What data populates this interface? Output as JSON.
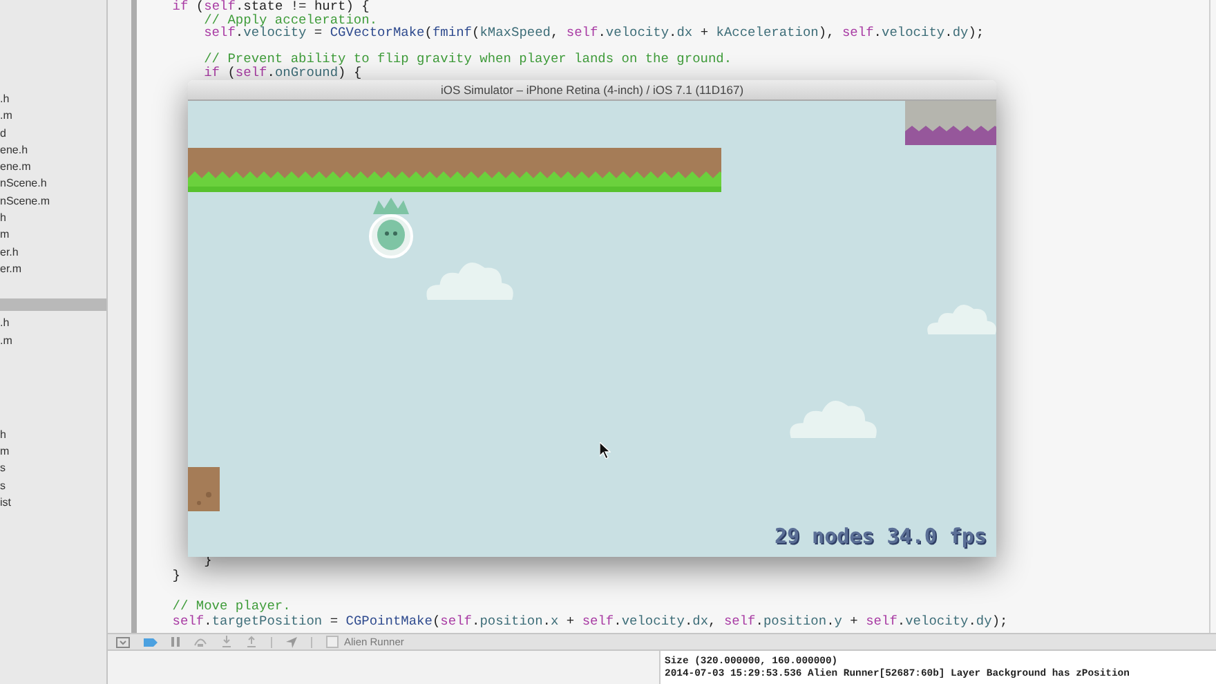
{
  "sidebar": {
    "groups": [
      {
        "items": [
          ".h",
          ".m",
          "d",
          "ene.h",
          "ene.m",
          "nScene.h",
          "nScene.m",
          "h",
          "m",
          "er.h",
          "er.m"
        ]
      },
      {
        "items": [
          ".h",
          ".m"
        ]
      },
      {
        "items": [
          "h",
          "m",
          "s",
          "s",
          "ist"
        ]
      }
    ]
  },
  "editor": {
    "lines_top": [
      {
        "kind": "code",
        "segments": [
          {
            "text": "    if",
            "kind": "kw"
          },
          {
            "text": " (",
            "kind": "plain"
          },
          {
            "text": "self",
            "kind": "kw"
          },
          {
            "text": ".state != hurt) {",
            "kind": "plain"
          }
        ]
      },
      {
        "kind": "code",
        "segments": [
          {
            "text": "        // Apply acceleration.",
            "kind": "comment"
          }
        ]
      },
      {
        "kind": "code",
        "segments": [
          {
            "text": "        self",
            "kind": "kw"
          },
          {
            "text": ".",
            "kind": "plain"
          },
          {
            "text": "velocity",
            "kind": "ident"
          },
          {
            "text": " = ",
            "kind": "plain"
          },
          {
            "text": "CGVectorMake",
            "kind": "func"
          },
          {
            "text": "(",
            "kind": "plain"
          },
          {
            "text": "fminf",
            "kind": "func"
          },
          {
            "text": "(",
            "kind": "plain"
          },
          {
            "text": "kMaxSpeed",
            "kind": "ident"
          },
          {
            "text": ", ",
            "kind": "plain"
          },
          {
            "text": "self",
            "kind": "kw"
          },
          {
            "text": ".",
            "kind": "plain"
          },
          {
            "text": "velocity",
            "kind": "ident"
          },
          {
            "text": ".",
            "kind": "plain"
          },
          {
            "text": "dx",
            "kind": "ident"
          },
          {
            "text": " + ",
            "kind": "plain"
          },
          {
            "text": "kAcceleration",
            "kind": "ident"
          },
          {
            "text": "), ",
            "kind": "plain"
          },
          {
            "text": "self",
            "kind": "kw"
          },
          {
            "text": ".",
            "kind": "plain"
          },
          {
            "text": "velocity",
            "kind": "ident"
          },
          {
            "text": ".",
            "kind": "plain"
          },
          {
            "text": "dy",
            "kind": "ident"
          },
          {
            "text": ");",
            "kind": "plain"
          }
        ]
      },
      {
        "kind": "blank"
      },
      {
        "kind": "code",
        "segments": [
          {
            "text": "        // Prevent ability to flip gravity when player lands on the ground.",
            "kind": "comment"
          }
        ]
      },
      {
        "kind": "code",
        "segments": [
          {
            "text": "        if",
            "kind": "kw"
          },
          {
            "text": " (",
            "kind": "plain"
          },
          {
            "text": "self",
            "kind": "kw"
          },
          {
            "text": ".",
            "kind": "plain"
          },
          {
            "text": "onGround",
            "kind": "ident"
          },
          {
            "text": ") {",
            "kind": "plain"
          }
        ]
      }
    ],
    "lines_bottom": [
      {
        "kind": "code",
        "segments": [
          {
            "text": "        }",
            "kind": "plain"
          }
        ]
      },
      {
        "kind": "code",
        "segments": [
          {
            "text": "    }",
            "kind": "plain"
          }
        ]
      },
      {
        "kind": "blank"
      },
      {
        "kind": "code",
        "segments": [
          {
            "text": "    // Move player.",
            "kind": "comment"
          }
        ]
      },
      {
        "kind": "code",
        "segments": [
          {
            "text": "    self",
            "kind": "kw"
          },
          {
            "text": ".",
            "kind": "plain"
          },
          {
            "text": "targetPosition",
            "kind": "ident"
          },
          {
            "text": " = ",
            "kind": "plain"
          },
          {
            "text": "CGPointMake",
            "kind": "func"
          },
          {
            "text": "(",
            "kind": "plain"
          },
          {
            "text": "self",
            "kind": "kw"
          },
          {
            "text": ".",
            "kind": "plain"
          },
          {
            "text": "position",
            "kind": "ident"
          },
          {
            "text": ".",
            "kind": "plain"
          },
          {
            "text": "x",
            "kind": "ident"
          },
          {
            "text": " + ",
            "kind": "plain"
          },
          {
            "text": "self",
            "kind": "kw"
          },
          {
            "text": ".",
            "kind": "plain"
          },
          {
            "text": "velocity",
            "kind": "ident"
          },
          {
            "text": ".",
            "kind": "plain"
          },
          {
            "text": "dx",
            "kind": "ident"
          },
          {
            "text": ", ",
            "kind": "plain"
          },
          {
            "text": "self",
            "kind": "kw"
          },
          {
            "text": ".",
            "kind": "plain"
          },
          {
            "text": "position",
            "kind": "ident"
          },
          {
            "text": ".",
            "kind": "plain"
          },
          {
            "text": "y",
            "kind": "ident"
          },
          {
            "text": " + ",
            "kind": "plain"
          },
          {
            "text": "self",
            "kind": "kw"
          },
          {
            "text": ".",
            "kind": "plain"
          },
          {
            "text": "velocity",
            "kind": "ident"
          },
          {
            "text": ".",
            "kind": "plain"
          },
          {
            "text": "dy",
            "kind": "ident"
          },
          {
            "text": ");",
            "kind": "plain"
          }
        ]
      }
    ]
  },
  "simulator": {
    "title": "iOS Simulator – iPhone Retina (4-inch) / iOS 7.1 (11D167)",
    "stats": "29 nodes 34.0 fps"
  },
  "debug_bar": {
    "target": "Alien Runner"
  },
  "console": {
    "lines": [
      "Size (320.000000, 160.000000)",
      "2014-07-03 15:29:53.536 Alien Runner[52687:60b] Layer Background has zPosition"
    ]
  }
}
